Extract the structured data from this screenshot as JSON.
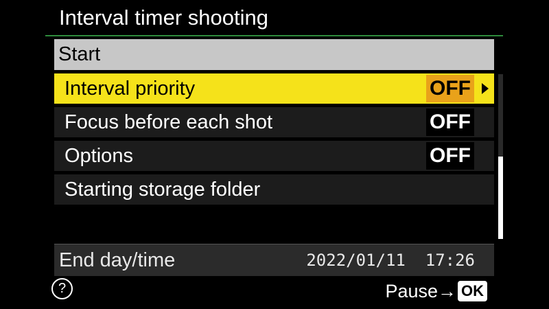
{
  "screen": {
    "title": "Interval timer shooting"
  },
  "menu": {
    "start_label": "Start",
    "items": [
      {
        "label": "Interval priority",
        "value": "OFF",
        "selected": true
      },
      {
        "label": "Focus before each shot",
        "value": "OFF",
        "selected": false
      },
      {
        "label": "Options",
        "value": "OFF",
        "selected": false
      },
      {
        "label": "Starting storage folder",
        "value": "",
        "selected": false
      }
    ]
  },
  "end_time": {
    "label": "End day/time",
    "date": "2022/01/11",
    "time": "17:26",
    "display": "2022/01/11  17:26"
  },
  "footer": {
    "help_symbol": "?",
    "hint_text": "Pause→",
    "ok_label": "OK"
  },
  "scrollbar": {
    "thumb_start_fraction": 0.5,
    "thumb_end_fraction": 1.0
  },
  "colors": {
    "highlight": "#f5e21a",
    "highlight_value": "#e9a21a",
    "header_bar": "#c7c7c7",
    "rule": "#2e8b3c"
  },
  "icons": {
    "help": "help-question-icon",
    "submenu": "chevron-right-icon"
  }
}
